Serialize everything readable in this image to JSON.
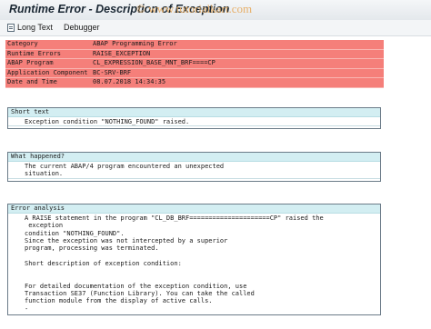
{
  "window": {
    "title": "Runtime Error - Description of Exception",
    "watermark": "© www.tutorialkart.com"
  },
  "toolbar": {
    "long_text_label": "Long Text",
    "debugger_label": "Debugger"
  },
  "header": {
    "rows": [
      {
        "label": "Category",
        "value": "ABAP Programming Error"
      },
      {
        "label": "Runtime Errors",
        "value": "RAISE_EXCEPTION"
      },
      {
        "label": "ABAP Program",
        "value": "CL_EXPRESSION_BASE_MNT_BRF====CP"
      },
      {
        "label": "Application Component",
        "value": "BC-SRV-BRF"
      },
      {
        "label": "Date and Time",
        "value": "08.07.2018 14:34:35"
      }
    ]
  },
  "short_text": {
    "heading": "Short text",
    "lines": [
      "Exception condition \"NOTHING_FOUND\" raised."
    ]
  },
  "what_happened": {
    "heading": "What happened?",
    "lines": [
      "The current ABAP/4 program encountered an unexpected",
      "situation."
    ]
  },
  "error_analysis": {
    "heading": "Error analysis",
    "lines": [
      "A RAISE statement in the program \"CL_DB_BRF=====================CP\" raised the",
      " exception",
      "condition \"NOTHING_FOUND\".",
      "Since the exception was not intercepted by a superior",
      "program, processing was terminated.",
      "",
      "Short description of exception condition:",
      "",
      "",
      "For detailed documentation of the exception condition, use",
      "Transaction SE37 (Function Library). You can take the called",
      "function module from the display of active calls.",
      "-"
    ]
  }
}
